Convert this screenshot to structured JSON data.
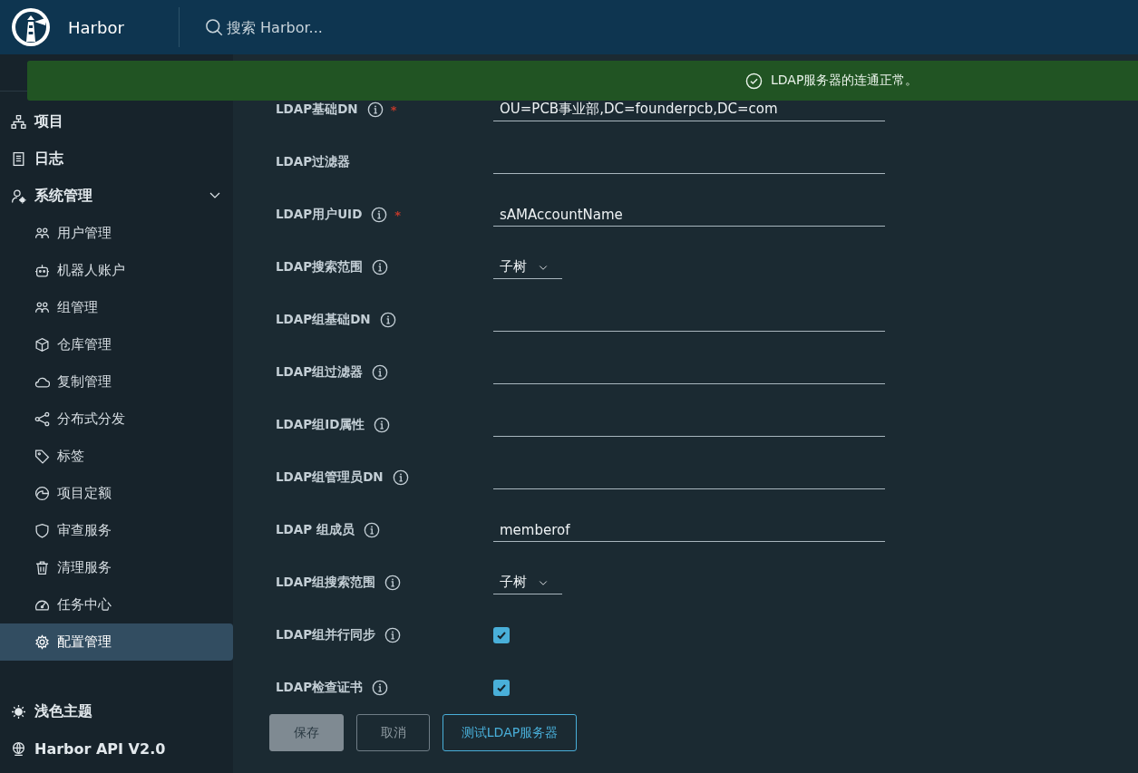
{
  "header": {
    "app_name": "Harbor",
    "search_placeholder": "搜索 Harbor..."
  },
  "sidebar": {
    "items": [
      {
        "label": "项目",
        "selected": false
      },
      {
        "label": "日志",
        "selected": false
      },
      {
        "label": "系统管理",
        "selected": false,
        "expanded": true,
        "children": [
          {
            "label": "用户管理",
            "selected": false
          },
          {
            "label": "机器人账户",
            "selected": false
          },
          {
            "label": "组管理",
            "selected": false
          },
          {
            "label": "仓库管理",
            "selected": false
          },
          {
            "label": "复制管理",
            "selected": false
          },
          {
            "label": "分布式分发",
            "selected": false
          },
          {
            "label": "标签",
            "selected": false
          },
          {
            "label": "项目定额",
            "selected": false
          },
          {
            "label": "审查服务",
            "selected": false
          },
          {
            "label": "清理服务",
            "selected": false
          },
          {
            "label": "任务中心",
            "selected": false
          },
          {
            "label": "配置管理",
            "selected": true
          }
        ]
      }
    ],
    "footer": [
      {
        "label": "浅色主题"
      },
      {
        "label": "Harbor API V2.0"
      }
    ]
  },
  "alert": {
    "text": "LDAP服务器的连通正常。"
  },
  "form": {
    "rows": [
      {
        "label": "LDAP基础DN",
        "info": true,
        "required_mark": "*",
        "kind": "text",
        "value": "OU=PCB事业部,DC=founderpcb,DC=com"
      },
      {
        "label": "LDAP过滤器",
        "info": false,
        "kind": "text"
      },
      {
        "label": "LDAP用户UID",
        "info": true,
        "required_mark": "*",
        "kind": "text",
        "value": "sAMAccountName"
      },
      {
        "label": "LDAP搜索范围",
        "info": true,
        "kind": "select",
        "value": "子树"
      },
      {
        "label": "LDAP组基础DN",
        "info": true,
        "kind": "text"
      },
      {
        "label": "LDAP组过滤器",
        "info": true,
        "kind": "text"
      },
      {
        "label": "LDAP组ID属性",
        "info": true,
        "kind": "text"
      },
      {
        "label": "LDAP组管理员DN",
        "info": true,
        "kind": "text"
      },
      {
        "label": "LDAP 组成员",
        "info": true,
        "kind": "text",
        "value": "memberof"
      },
      {
        "label": "LDAP组搜索范围",
        "info": true,
        "kind": "select",
        "value": "子树"
      },
      {
        "label": "LDAP组并行同步",
        "info": true,
        "kind": "checkbox",
        "checked": true
      },
      {
        "label": "LDAP检查证书",
        "info": true,
        "kind": "checkbox",
        "checked": true
      }
    ],
    "buttons": [
      {
        "label": "保存",
        "kind": "solid",
        "disabled": true
      },
      {
        "label": "取消",
        "kind": "outline",
        "disabled": true
      },
      {
        "label": "测试LDAP服务器",
        "kind": "outline",
        "disabled": false
      }
    ]
  }
}
